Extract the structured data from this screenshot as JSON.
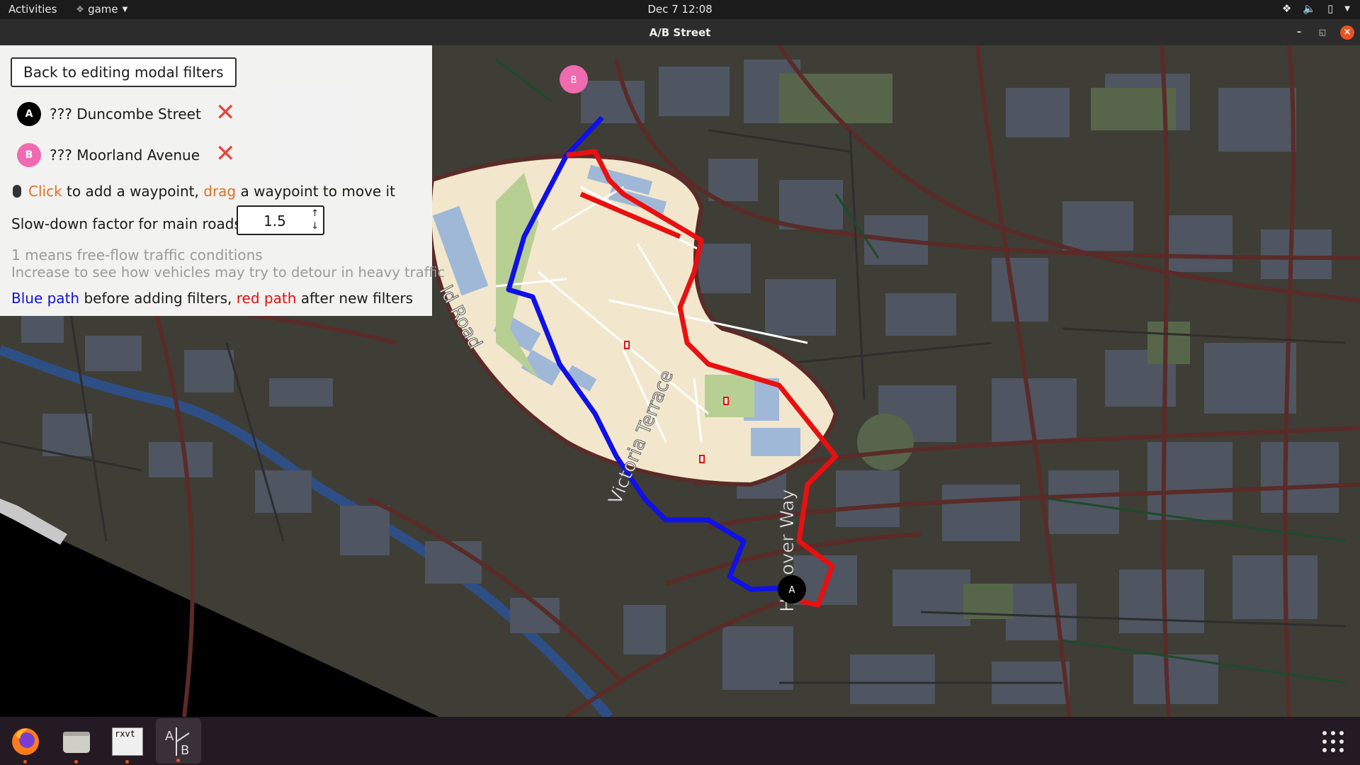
{
  "topbar": {
    "activities": "Activities",
    "app_menu": "game",
    "clock": "Dec 7  12:08",
    "tray_icons": [
      "dropbox-icon",
      "volume-icon",
      "battery-icon",
      "system-menu-chevron-icon"
    ]
  },
  "window": {
    "title": "A/B Street",
    "controls": [
      "minimize",
      "maximize",
      "close"
    ]
  },
  "panel": {
    "back_button": "Back to editing modal filters",
    "waypoints": [
      {
        "marker": "A",
        "name": "??? Duncombe Street",
        "color": "#000000"
      },
      {
        "marker": "B",
        "name": "??? Moorland Avenue",
        "color": "#f06ab0"
      }
    ],
    "instructions": {
      "click": "Click",
      "text1": " to add a waypoint, ",
      "drag": "drag",
      "text2": " a waypoint to move it"
    },
    "slowdown_label": "Slow-down factor for main roads:",
    "slowdown_value": "1.5",
    "help_line1": "1 means free-flow traffic conditions",
    "help_line2": "Increase to see how vehicles may try to detour in heavy traffic",
    "legend": {
      "blue": "Blue path",
      "text1": " before adding filters, ",
      "red": "red path",
      "text2": " after new filters"
    }
  },
  "map": {
    "street_labels": [
      "Victoria Terrace",
      "Hanover Way",
      "ld Road"
    ],
    "marker_a": "A",
    "marker_b": "B",
    "colors": {
      "background": "#3e3e36",
      "buildings": "#4f5561",
      "neighbourhood": "#f2e7cc",
      "main_roads": "#5a2b28",
      "blue_path": "#1010e8",
      "red_path": "#e81010",
      "park": "#b8cf94"
    }
  },
  "taskbar": {
    "apps": [
      "firefox-icon",
      "files-icon",
      "terminal-icon",
      "abstreet-icon"
    ],
    "terminal_label": "rxvt",
    "show_apps": "apps-grid-icon"
  }
}
